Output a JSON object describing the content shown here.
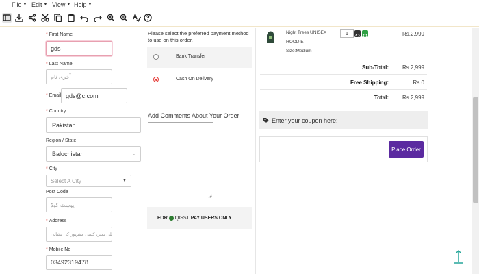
{
  "menu": {
    "items": [
      {
        "label": "File"
      },
      {
        "label": "Edit"
      },
      {
        "label": "View"
      },
      {
        "label": "Help"
      }
    ]
  },
  "form": {
    "first_name": {
      "label": "First Name",
      "value": "gds"
    },
    "last_name": {
      "label": "Last Name",
      "placeholder": "آخری نام"
    },
    "email": {
      "label": "Email",
      "value": "gds@c.com"
    },
    "country": {
      "label": "Country",
      "value": "Pakistan"
    },
    "region": {
      "label": "Region / State",
      "value": "Balochistan"
    },
    "city": {
      "label": "City",
      "placeholder": "Select A City"
    },
    "post_code": {
      "label": "Post Code",
      "placeholder": "پوسٹ کوڈ"
    },
    "address": {
      "label": "Address",
      "placeholder": "ر ، گلی نمبر، کسی مشہور کی نشانی"
    },
    "mobile": {
      "label": "Mobile No",
      "value": "03492319478"
    }
  },
  "payment": {
    "title": "Please select the preferred payment method to use on this order.",
    "options": [
      {
        "label": "Bank Transfer",
        "selected": false
      },
      {
        "label": "Cash On Delivery",
        "selected": true
      }
    ],
    "comments_title": "Add Comments About Your Order",
    "qisst": {
      "prefix": "FOR",
      "brand": "QISST",
      "suffix": "PAY USERS ONLY"
    }
  },
  "cart": {
    "product": {
      "name_line1": "Night Trees UNISEX",
      "name_line2": "HOODIE",
      "size": "Size:Medium",
      "quantity": "1",
      "price": "Rs.2,999"
    },
    "summary": [
      {
        "label": "Sub-Total:",
        "value": "Rs.2,999"
      },
      {
        "label": "Free Shipping:",
        "value": "Rs.0"
      },
      {
        "label": "Total:",
        "value": "Rs.2,999"
      }
    ],
    "coupon_label": "Enter your coupon here:",
    "place_order_label": "Place Order"
  },
  "colors": {
    "accent_purple": "#5b2aa0",
    "required_red": "#e53935",
    "focus_pink": "#e8a0b0",
    "scroll_top_teal": "#26a69a"
  },
  "icons": {
    "toolbar": [
      "panel-icon",
      "download-icon",
      "share-icon",
      "cut-icon",
      "copy-icon",
      "paste-icon",
      "undo-icon",
      "redo-icon",
      "zoom-in-icon",
      "zoom-out-icon",
      "spellcheck-icon",
      "help-icon"
    ]
  }
}
